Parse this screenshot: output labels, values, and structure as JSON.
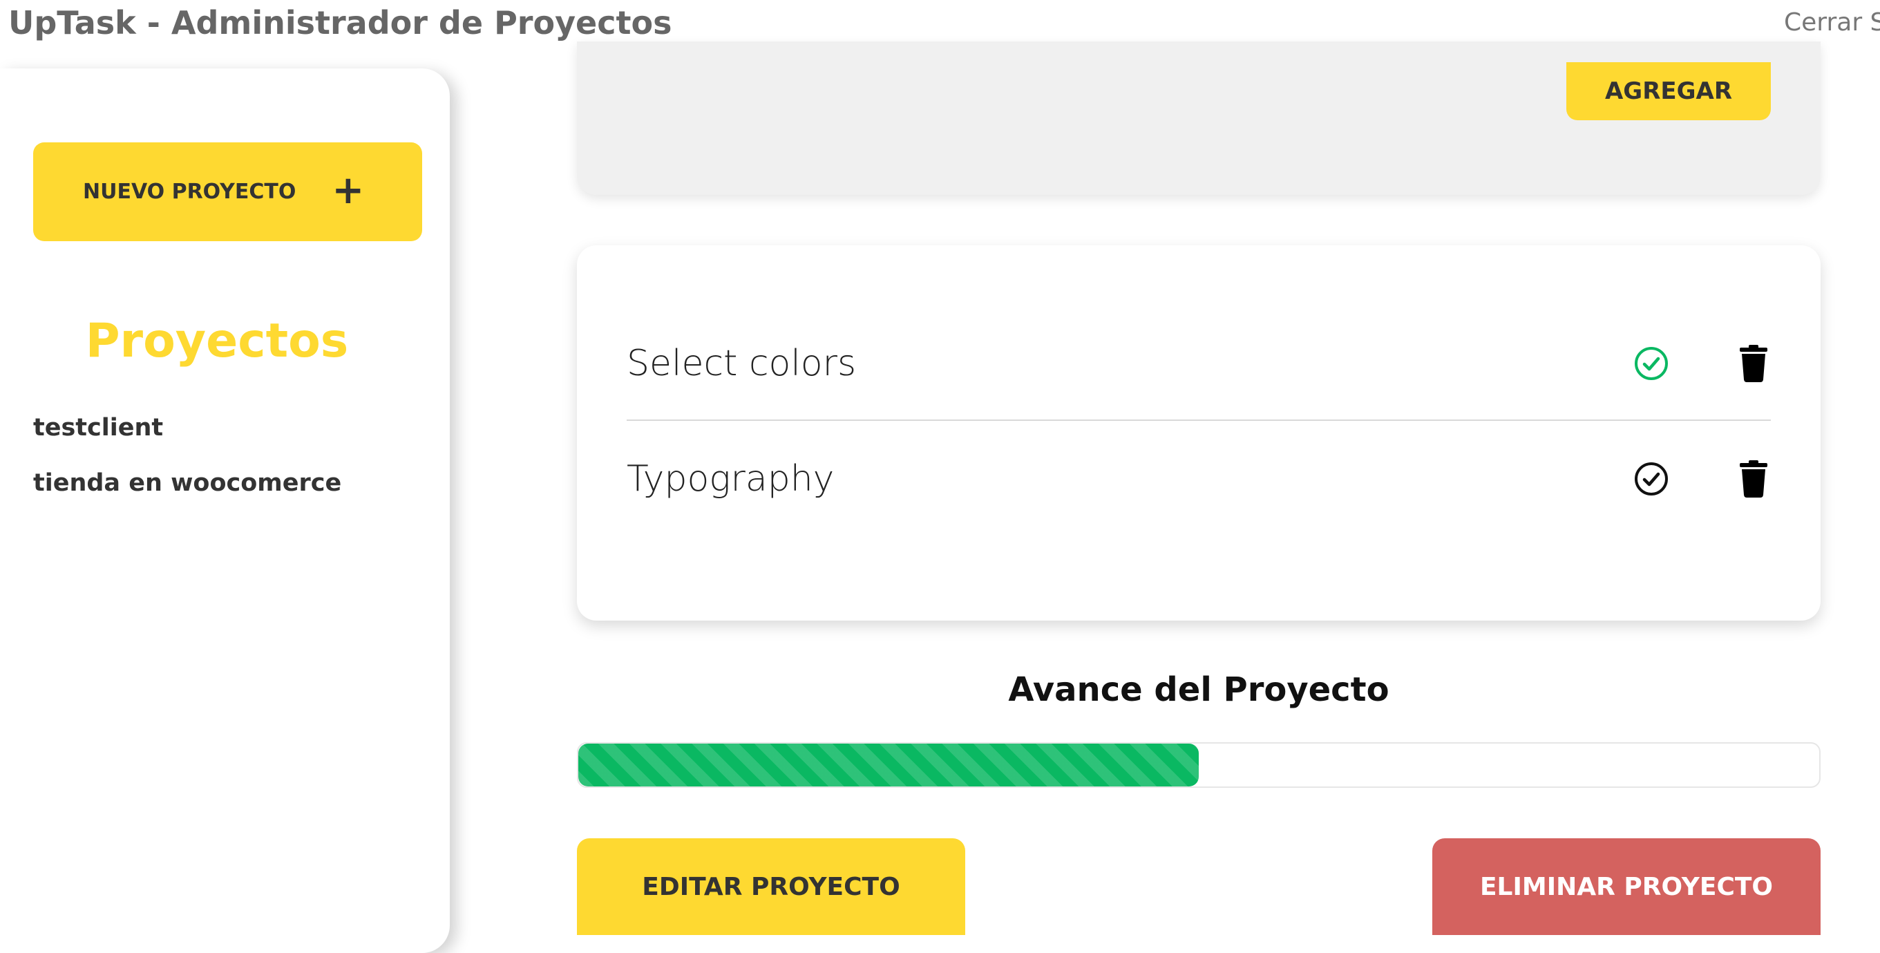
{
  "header": {
    "title": "UpTask - Administrador de Proyectos",
    "logout_label": "Cerrar S"
  },
  "sidebar": {
    "new_project_label": "NUEVO PROYECTO",
    "new_project_icon": "+",
    "projects_heading": "Proyectos",
    "projects": [
      {
        "name": "testclient"
      },
      {
        "name": "tienda en woocomerce"
      }
    ]
  },
  "task_form": {
    "add_label": "AGREGAR"
  },
  "tasks": [
    {
      "name": "Select colors",
      "completed": true,
      "check_color": "#0ab862"
    },
    {
      "name": "Typography",
      "completed": false,
      "check_color": "#111111"
    }
  ],
  "progress": {
    "title": "Avance del Proyecto",
    "percent": 50,
    "fill_color": "#0ab862"
  },
  "actions": {
    "edit_label": "EDITAR PROYECTO",
    "delete_label": "ELIMINAR PROYECTO"
  },
  "colors": {
    "accent": "#fed931",
    "danger": "#d4625f",
    "success": "#0ab862"
  }
}
